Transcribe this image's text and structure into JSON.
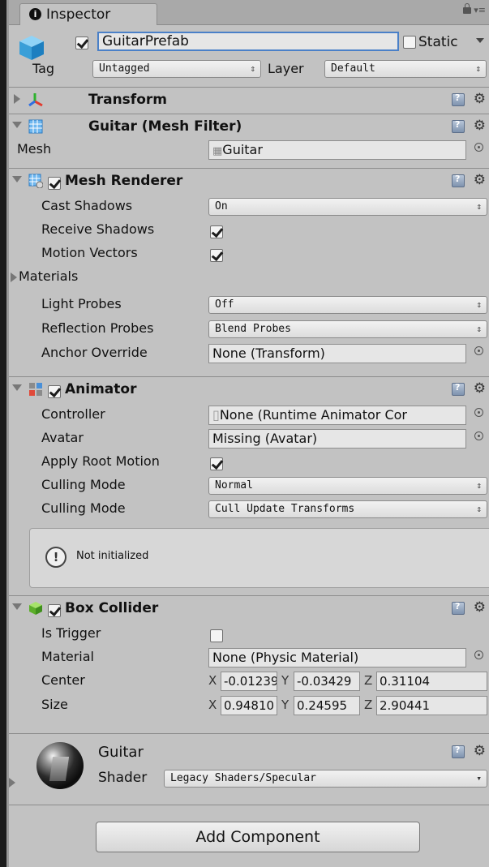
{
  "window": {
    "tab_label": "Inspector"
  },
  "object": {
    "name": "GuitarPrefab",
    "active": true,
    "static_label": "Static",
    "static": false,
    "tag_label": "Tag",
    "tag": "Untagged",
    "layer_label": "Layer",
    "layer": "Default"
  },
  "transform": {
    "title": "Transform"
  },
  "mesh_filter": {
    "title": "Guitar (Mesh Filter)",
    "mesh_label": "Mesh",
    "mesh_value": "Guitar"
  },
  "mesh_renderer": {
    "title": "Mesh Renderer",
    "enabled": true,
    "cast_shadows_label": "Cast Shadows",
    "cast_shadows": "On",
    "receive_shadows_label": "Receive Shadows",
    "receive_shadows": true,
    "motion_vectors_label": "Motion Vectors",
    "motion_vectors": true,
    "materials_label": "Materials",
    "light_probes_label": "Light Probes",
    "light_probes": "Off",
    "reflection_probes_label": "Reflection Probes",
    "reflection_probes": "Blend Probes",
    "anchor_override_label": "Anchor Override",
    "anchor_override": "None (Transform)"
  },
  "animator": {
    "title": "Animator",
    "enabled": true,
    "controller_label": "Controller",
    "controller": "None (Runtime Animator Cor",
    "avatar_label": "Avatar",
    "avatar": "Missing (Avatar)",
    "apply_root_motion_label": "Apply Root Motion",
    "apply_root_motion": true,
    "culling_mode_label": "Culling Mode",
    "culling_mode": "Normal",
    "culling_mode2_label": "Culling Mode",
    "culling_mode2": "Cull Update Transforms",
    "help_text": "Not initialized"
  },
  "box_collider": {
    "title": "Box Collider",
    "enabled": true,
    "is_trigger_label": "Is Trigger",
    "is_trigger": false,
    "material_label": "Material",
    "material": "None (Physic Material)",
    "center_label": "Center",
    "center": {
      "x": "-0.01239",
      "y": "-0.03429",
      "z": "0.31104"
    },
    "size_label": "Size",
    "size": {
      "x": "0.94810",
      "y": "0.24595",
      "z": "2.90441"
    },
    "axis_x": "X",
    "axis_y": "Y",
    "axis_z": "Z"
  },
  "material_section": {
    "name": "Guitar",
    "shader_label": "Shader",
    "shader": "Legacy Shaders/Specular"
  },
  "footer": {
    "add_component": "Add Component"
  }
}
